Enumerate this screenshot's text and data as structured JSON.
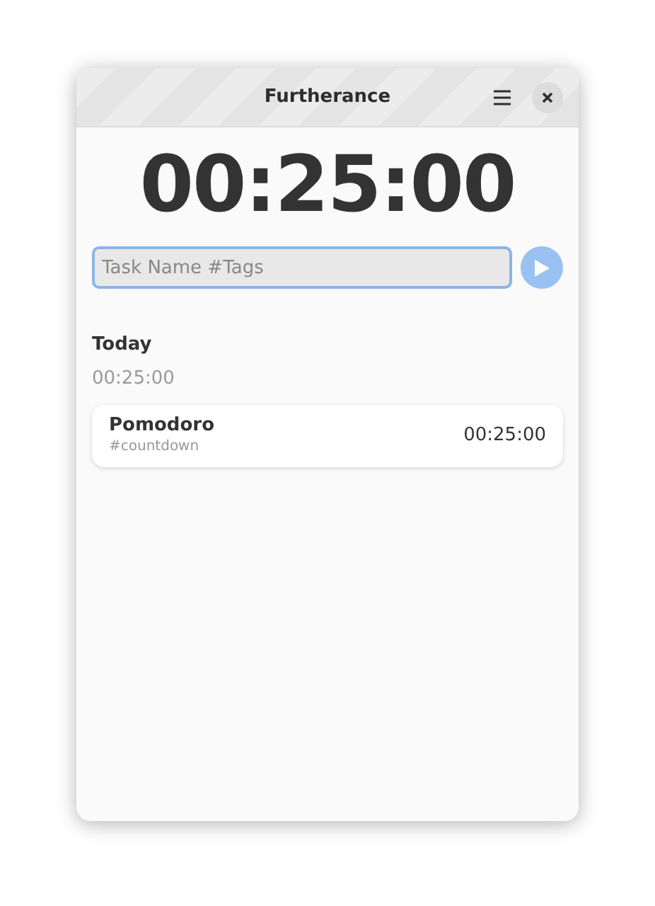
{
  "window": {
    "title": "Furtherance"
  },
  "timer": "00:25:00",
  "task_field": {
    "placeholder": "Task Name #Tags"
  },
  "days": [
    {
      "title": "Today",
      "total": "00:25:00",
      "tasks": [
        {
          "name": "Pomodoro",
          "tags": "#countdown",
          "duration": "00:25:00"
        }
      ]
    }
  ]
}
